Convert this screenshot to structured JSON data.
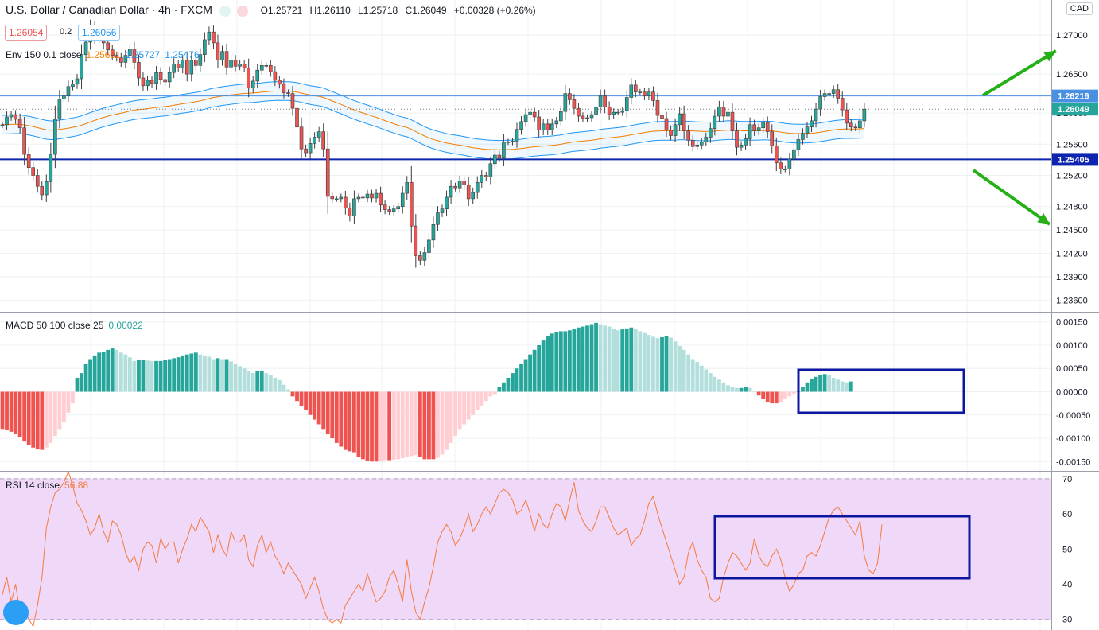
{
  "header": {
    "symbol": "U.S. Dollar / Canadian Dollar · 4h · FXCM",
    "ohlc": {
      "o": "O1.25721",
      "h": "H1.26110",
      "l": "L1.25718",
      "c": "C1.26049",
      "chg": "+0.00328 (+0.26%)"
    },
    "bid_box": "1.26054",
    "spread": "0.2",
    "ask_box": "1.26056",
    "currency_badge": "CAD"
  },
  "colors": {
    "up": "#26a69a",
    "down": "#ef5350",
    "env_mid": "#f57c00",
    "env_band": "#2196f3",
    "hline_dark": "#0c24b0",
    "hline_light": "#4a90e2",
    "macd_up": "#26a69a",
    "macd_up_light": "#b2dfdb",
    "macd_dn": "#ef5350",
    "macd_dn_light": "#ffcdd2",
    "rsi_line": "#f47b3e",
    "rsi_band": "#efd8f8",
    "rect": "#0c16a0",
    "arrow": "#25b018"
  },
  "legends": {
    "env": {
      "label": "Env 150 0.1 close",
      "v1": "1.25601",
      "v2": "1.25727",
      "v3": "1.25476"
    },
    "macd": {
      "label": "MACD 50 100 close 25",
      "value": "0.00022"
    },
    "rsi": {
      "label": "RSI 14 close",
      "value": "56.88"
    }
  },
  "price_axis": {
    "ticks": [
      "1.27000",
      "1.26500",
      "1.26000",
      "1.25600",
      "1.25200",
      "1.24800",
      "1.24500",
      "1.24200",
      "1.23900",
      "1.23600"
    ],
    "labels": [
      {
        "text": "1.26219",
        "kind": "hline_light"
      },
      {
        "text": "1.26049",
        "kind": "last"
      },
      {
        "text": "1.25405",
        "kind": "hline_dark"
      }
    ]
  },
  "macd_axis": {
    "ticks": [
      "0.00150",
      "0.00100",
      "0.00050",
      "0.00000",
      "-0.00050",
      "-0.00100",
      "-0.00150"
    ]
  },
  "rsi_axis": {
    "ticks": [
      "70",
      "60",
      "50",
      "40",
      "30"
    ]
  },
  "chart_data": [
    {
      "type": "candlestick",
      "title": "U.S. Dollar / Canadian Dollar · 4h · FXCM",
      "ylim": [
        1.2345,
        1.2745
      ],
      "overlays": [
        "Env 150 0.1 close"
      ],
      "horizontal_lines": [
        1.26219,
        1.25405
      ],
      "closes": [
        1.2585,
        1.2595,
        1.2598,
        1.2592,
        1.2581,
        1.2547,
        1.253,
        1.252,
        1.2506,
        1.2495,
        1.2512,
        1.2547,
        1.2592,
        1.2618,
        1.2622,
        1.2634,
        1.2637,
        1.2644,
        1.2675,
        1.2691,
        1.271,
        1.2697,
        1.2705,
        1.269,
        1.2681,
        1.2674,
        1.2671,
        1.2665,
        1.2674,
        1.2682,
        1.2665,
        1.2645,
        1.2635,
        1.2642,
        1.2638,
        1.2652,
        1.2643,
        1.264,
        1.2652,
        1.2663,
        1.2658,
        1.2668,
        1.265,
        1.2668,
        1.2661,
        1.2675,
        1.2694,
        1.2704,
        1.269,
        1.2668,
        1.2679,
        1.2659,
        1.2668,
        1.266,
        1.2663,
        1.2658,
        1.2632,
        1.2641,
        1.2655,
        1.2661,
        1.2661,
        1.2653,
        1.2642,
        1.2637,
        1.2626,
        1.2625,
        1.2606,
        1.2582,
        1.2554,
        1.2549,
        1.2561,
        1.2569,
        1.2576,
        1.2554,
        1.2493,
        1.249,
        1.249,
        1.2492,
        1.2478,
        1.2468,
        1.249,
        1.2492,
        1.2491,
        1.2496,
        1.2491,
        1.2497,
        1.2482,
        1.2476,
        1.2474,
        1.2477,
        1.248,
        1.2497,
        1.2511,
        1.2455,
        1.2417,
        1.2411,
        1.2421,
        1.2437,
        1.2457,
        1.2472,
        1.2477,
        1.2492,
        1.2506,
        1.2504,
        1.2513,
        1.2508,
        1.249,
        1.2498,
        1.2511,
        1.252,
        1.2518,
        1.2535,
        1.2546,
        1.2542,
        1.2563,
        1.2563,
        1.2564,
        1.2579,
        1.2589,
        1.2598,
        1.2601,
        1.2595,
        1.2578,
        1.2586,
        1.2578,
        1.2586,
        1.259,
        1.2602,
        1.2625,
        1.2617,
        1.2606,
        1.2596,
        1.2593,
        1.2594,
        1.2598,
        1.2608,
        1.2622,
        1.2608,
        1.2598,
        1.2601,
        1.2601,
        1.2603,
        1.262,
        1.2636,
        1.2627,
        1.2627,
        1.2622,
        1.2627,
        1.2616,
        1.2597,
        1.2593,
        1.2578,
        1.2571,
        1.2585,
        1.2599,
        1.2577,
        1.2565,
        1.2557,
        1.2559,
        1.2563,
        1.2569,
        1.258,
        1.2596,
        1.2608,
        1.2596,
        1.2601,
        1.2577,
        1.2556,
        1.2559,
        1.2567,
        1.2585,
        1.2577,
        1.2581,
        1.2588,
        1.2576,
        1.2558,
        1.2536,
        1.2528,
        1.2528,
        1.2541,
        1.2553,
        1.2566,
        1.2574,
        1.2582,
        1.259,
        1.2605,
        1.2621,
        1.2625,
        1.2625,
        1.263,
        1.2619,
        1.2604,
        1.2587,
        1.2582,
        1.2581,
        1.259,
        1.2605
      ]
    },
    {
      "type": "bar",
      "title": "MACD 50 100 close 25",
      "ylim": [
        -0.0017,
        0.0017
      ],
      "values": [
        -0.0008,
        -0.00082,
        -0.00086,
        -0.0009,
        -0.00098,
        -0.00107,
        -0.00115,
        -0.0012,
        -0.00124,
        -0.00125,
        -0.0012,
        -0.0011,
        -0.00095,
        -0.0008,
        -0.00065,
        -0.00045,
        -0.00025,
        0.0003,
        0.0004,
        0.0006,
        0.0007,
        0.00078,
        0.00084,
        0.00086,
        0.0009,
        0.00093,
        0.0009,
        0.00084,
        0.0008,
        0.00074,
        0.00066,
        0.00068,
        0.00068,
        0.00067,
        0.00066,
        0.00066,
        0.00066,
        0.00068,
        0.0007,
        0.00072,
        0.00074,
        0.00078,
        0.0008,
        0.00082,
        0.00084,
        0.0008,
        0.00078,
        0.00075,
        0.0007,
        0.00072,
        0.0007,
        0.0007,
        0.00065,
        0.0006,
        0.00055,
        0.0005,
        0.00045,
        0.0004,
        0.00045,
        0.00045,
        0.0004,
        0.00035,
        0.0003,
        0.00025,
        0.00015,
        5e-05,
        -0.0001,
        -0.0002,
        -0.0003,
        -0.0004,
        -0.0005,
        -0.0006,
        -0.0007,
        -0.0008,
        -0.0009,
        -0.001,
        -0.0011,
        -0.00118,
        -0.00125,
        -0.00128,
        -0.0013,
        -0.0014,
        -0.00145,
        -0.00148,
        -0.0015,
        -0.0015,
        -0.00148,
        -0.00147,
        -0.00147,
        -0.00146,
        -0.00145,
        -0.00143,
        -0.0014,
        -0.00138,
        -0.00136,
        -0.0014,
        -0.00145,
        -0.00145,
        -0.00145,
        -0.00142,
        -0.00135,
        -0.00125,
        -0.0011,
        -0.00095,
        -0.0008,
        -0.0007,
        -0.0006,
        -0.0005,
        -0.0004,
        -0.0003,
        -0.0002,
        -0.0001,
        -5e-05,
        0.0001,
        0.0002,
        0.0003,
        0.0004,
        0.0005,
        0.0006,
        0.0007,
        0.0008,
        0.0009,
        0.001,
        0.0011,
        0.0012,
        0.00125,
        0.00128,
        0.0013,
        0.0013,
        0.00132,
        0.00135,
        0.00138,
        0.0014,
        0.00142,
        0.00145,
        0.00148,
        0.00145,
        0.00142,
        0.0014,
        0.00136,
        0.00132,
        0.00134,
        0.00136,
        0.00138,
        0.00136,
        0.0013,
        0.00126,
        0.00122,
        0.00118,
        0.00115,
        0.00117,
        0.0012,
        0.00116,
        0.00108,
        0.00098,
        0.0009,
        0.0008,
        0.0007,
        0.00064,
        0.00056,
        0.00048,
        0.0004,
        0.00032,
        0.00026,
        0.0002,
        0.00014,
        0.0001,
        8e-05,
        8e-05,
        0.0001,
        8e-05,
        2e-05,
        -8e-05,
        -0.00016,
        -0.00022,
        -0.00025,
        -0.00025,
        -0.00022,
        -0.00016,
        -0.0001,
        -4e-05,
        2e-05,
        0.0001,
        0.0002,
        0.00028,
        0.00032,
        0.00036,
        0.00038,
        0.00035,
        0.0003,
        0.00026,
        0.00022,
        0.0002,
        0.00022
      ]
    },
    {
      "type": "line",
      "title": "RSI 14 close",
      "ylim": [
        27,
        72
      ],
      "band": [
        30,
        70
      ],
      "values": [
        37,
        42,
        35,
        40,
        32,
        33,
        30,
        28,
        34,
        42,
        56,
        62,
        66,
        67,
        69,
        72,
        68,
        63,
        61,
        58,
        54,
        56,
        60,
        55,
        52,
        58,
        57,
        54,
        49,
        46,
        48,
        44,
        50,
        52,
        51,
        46,
        53,
        50,
        52,
        52,
        46,
        50,
        53,
        57,
        55,
        59,
        57,
        55,
        49,
        54,
        50,
        48,
        55,
        52,
        52,
        54,
        47,
        45,
        51,
        54,
        49,
        52,
        48,
        46,
        43,
        46,
        44,
        42,
        40,
        36,
        39,
        42,
        38,
        33,
        30,
        29,
        30,
        29,
        34,
        36,
        38,
        40,
        38,
        43,
        39,
        35,
        36,
        38,
        42,
        44,
        40,
        35,
        47,
        38,
        32,
        30,
        35,
        39,
        45,
        52,
        55,
        57,
        55,
        51,
        53,
        56,
        60,
        55,
        57,
        60,
        62,
        60,
        63,
        66,
        67,
        66,
        64,
        60,
        61,
        64,
        60,
        55,
        60,
        57,
        56,
        60,
        63,
        62,
        58,
        64,
        69,
        61,
        58,
        56,
        55,
        58,
        62,
        62,
        59,
        56,
        54,
        55,
        56,
        51,
        53,
        54,
        58,
        63,
        65,
        60,
        56,
        52,
        48,
        44,
        40,
        42,
        49,
        52,
        47,
        44,
        42,
        36,
        35,
        36,
        42,
        46,
        49,
        48,
        46,
        44,
        46,
        53,
        48,
        46,
        45,
        48,
        50,
        47,
        42,
        38,
        40,
        43,
        44,
        48,
        49,
        48,
        51,
        55,
        59,
        61,
        62,
        60,
        58,
        56,
        54,
        58,
        48,
        44,
        43,
        46,
        57
      ]
    }
  ]
}
